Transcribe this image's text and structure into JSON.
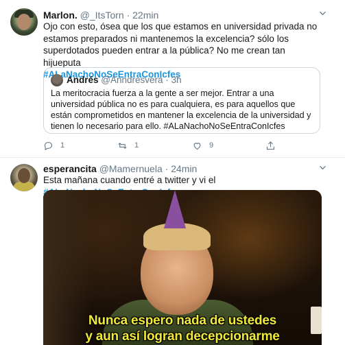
{
  "tweets": [
    {
      "name": "Marlon.",
      "handle": "@_ItsTorn",
      "separator": "·",
      "time": "22min",
      "text": "Ojo con esto, ósea que los que estamos en universidad privada no estamos preparados ni mantenemos la excelencia? sólo los superdotados pueden entrar a la pública? No me crean tan hijueputa",
      "hashtag": "#ALaNachoNoSeEntraConIcfes",
      "quote": {
        "name": "Andrés",
        "handle": "@Anndresvera",
        "separator": "·",
        "time": "3h",
        "text": "La meritocracia fuerza a la gente a ser mejor. Entrar a una universidad pública no es para cualquiera, es para aquellos que están comprometidos en mantener la excelencia de la universidad y tienen lo necesario para ello. #ALaNachoNoSeEntraConIcfes"
      },
      "actions": {
        "reply_count": "1",
        "retweet_count": "1",
        "like_count": "9"
      },
      "icons": [
        "reply-icon",
        "retweet-icon",
        "like-icon",
        "share-icon",
        "caret-down-icon"
      ]
    },
    {
      "name": "esperancita",
      "handle": "@Mamernuela",
      "separator": "·",
      "time": "24min",
      "text": "Esta mañana cuando entré a twitter y vi el ",
      "hashtag": "#ALaNachoNoSeEntraConIcfes",
      "media": {
        "subtitle_line1": "Nunca espero nada de ustedes",
        "subtitle_line2": "y aun así logran decepcionarme"
      }
    }
  ],
  "colors": {
    "link": "#1b95e0",
    "secondary_text": "#657786",
    "border": "#e6ecf0",
    "subtitle": "#f1e93a"
  }
}
